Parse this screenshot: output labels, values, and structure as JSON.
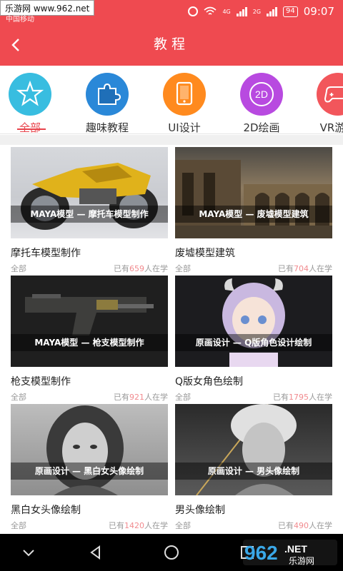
{
  "watermark": "乐游网 www.962.net",
  "status": {
    "carrier": "中国移动",
    "signal1": "4G",
    "signal2": "2G",
    "battery": "94",
    "time": "09:07"
  },
  "header": {
    "title": "教程"
  },
  "categories": [
    {
      "label": "全部",
      "icon": "star-badge-icon",
      "color": "#38bde0",
      "active": true
    },
    {
      "label": "趣味教程",
      "icon": "puzzle-icon",
      "color": "#2a88d8"
    },
    {
      "label": "UI设计",
      "icon": "tablet-icon",
      "color": "#ff8a1e"
    },
    {
      "label": "2D绘画",
      "icon": "2d-icon",
      "color": "#b84ae0",
      "badge": "2D"
    },
    {
      "label": "VR游戏",
      "icon": "gamepad-icon",
      "color": "#f2565b"
    }
  ],
  "courses": [
    {
      "banner": "MAYA模型 — 摩托车模型制作",
      "title": "摩托车模型制作",
      "tag": "全部",
      "pre": "已有",
      "count": "659",
      "post": "人在学"
    },
    {
      "banner": "MAYA模型 — 废墟模型建筑",
      "title": "废墟模型建筑",
      "tag": "全部",
      "pre": "已有",
      "count": "704",
      "post": "人在学"
    },
    {
      "banner": "MAYA模型 — 枪支模型制作",
      "title": "枪支模型制作",
      "tag": "全部",
      "pre": "已有",
      "count": "921",
      "post": "人在学"
    },
    {
      "banner": "原画设计 — Q版角色设计绘制",
      "title": "Q版女角色绘制",
      "tag": "全部",
      "pre": "已有",
      "count": "1795",
      "post": "人在学"
    },
    {
      "banner": "原画设计 — 黑白女头像绘制",
      "title": "黑白女头像绘制",
      "tag": "全部",
      "pre": "已有",
      "count": "1420",
      "post": "人在学"
    },
    {
      "banner": "原画设计 — 男头像绘制",
      "title": "男头像绘制",
      "tag": "全部",
      "pre": "已有",
      "count": "490",
      "post": "人在学"
    }
  ],
  "footer_logo": {
    "brand": "962",
    "suffix": ".NET",
    "sub": "乐游网"
  },
  "colors": {
    "primary": "#ef4a50",
    "accent_text": "#e8434b",
    "count_text": "#f18b8f"
  }
}
